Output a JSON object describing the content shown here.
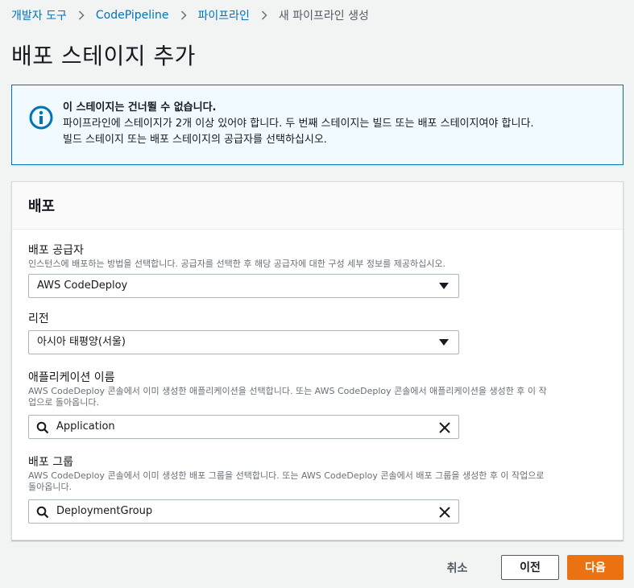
{
  "breadcrumb": {
    "items": [
      "개발자 도구",
      "CodePipeline",
      "파이프라인"
    ],
    "current": "새 파이프라인 생성"
  },
  "page": {
    "title": "배포 스테이지 추가"
  },
  "alert": {
    "title": "이 스테이지는 건너뛸 수 없습니다.",
    "line1": "파이프라인에 스테이지가 2개 이상 있어야 합니다. 두 번째 스테이지는 빌드 또는 배포 스테이지여야 합니다.",
    "line2": "빌드 스테이지 또는 배포 스테이지의 공급자를 선택하십시오."
  },
  "panel": {
    "title": "배포",
    "provider": {
      "label": "배포 공급자",
      "description": "인스턴스에 배포하는 방법을 선택합니다. 공급자를 선택한 후 해당 공급자에 대한 구성 세부 정보를 제공하십시오.",
      "value": "AWS CodeDeploy"
    },
    "region": {
      "label": "리전",
      "value": "아시아 태평양(서울)"
    },
    "application": {
      "label": "애플리케이션 이름",
      "description_line1": "AWS CodeDeploy 콘솔에서 이미 생성한 애플리케이션을 선택합니다. 또는 AWS CodeDeploy 콘솔에서 애플리케이션을 생성한 후 이 작",
      "description_line2": "업으로 돌아옵니다.",
      "value": "Application"
    },
    "deployment_group": {
      "label": "배포 그룹",
      "description_line1": "AWS CodeDeploy 콘솔에서 이미 생성한 배포 그룹을 선택합니다. 또는 AWS CodeDeploy 콘솔에서 배포 그룹을 생성한 후 이 작업으로",
      "description_line2": "돌아옵니다.",
      "value": "DeploymentGroup"
    }
  },
  "footer": {
    "cancel_label": "취소",
    "previous_label": "이전",
    "next_label": "다음"
  },
  "colors": {
    "link": "#0073bb",
    "primary_button": "#ec7211",
    "info_border": "#0073bb",
    "info_background": "#f1faff"
  },
  "icons": {
    "alert": "info-circle-icon",
    "breadcrumb_separator": "chevron-right-icon",
    "select": "caret-down-icon",
    "search": "search-icon",
    "clear": "close-icon"
  }
}
